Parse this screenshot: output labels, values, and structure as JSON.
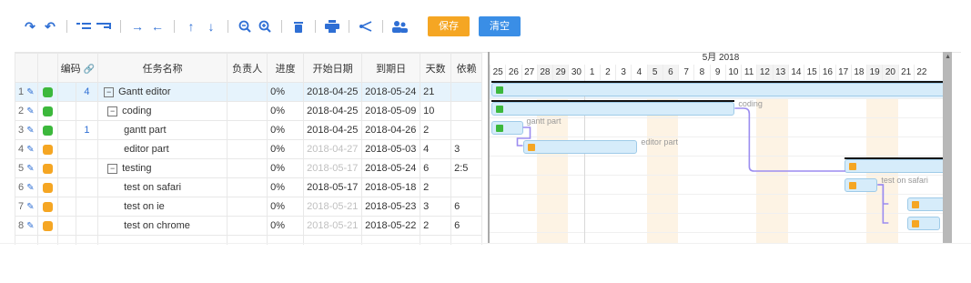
{
  "toolbar": {
    "save_label": "保存",
    "clear_label": "清空"
  },
  "grid": {
    "headers": [
      "编码",
      "任务名称",
      "负责人",
      "进度",
      "开始日期",
      "到期日",
      "天数",
      "依赖"
    ],
    "rows": [
      {
        "num": "1",
        "status": "green",
        "code": "4",
        "expand": "−",
        "name": "Gantt editor",
        "owner": "",
        "progress": "0%",
        "start": "2018-04-25",
        "start_muted": false,
        "end": "2018-05-24",
        "days": "21",
        "deps": ""
      },
      {
        "num": "2",
        "status": "green",
        "code": "",
        "expand": "−",
        "name": "coding",
        "owner": "",
        "progress": "0%",
        "start": "2018-04-25",
        "start_muted": false,
        "end": "2018-05-09",
        "days": "10",
        "deps": ""
      },
      {
        "num": "3",
        "status": "green",
        "code": "1",
        "expand": "",
        "name": "gantt part",
        "owner": "",
        "progress": "0%",
        "start": "2018-04-25",
        "start_muted": false,
        "end": "2018-04-26",
        "days": "2",
        "deps": ""
      },
      {
        "num": "4",
        "status": "orange",
        "code": "",
        "expand": "",
        "name": "editor part",
        "owner": "",
        "progress": "0%",
        "start": "2018-04-27",
        "start_muted": true,
        "end": "2018-05-03",
        "days": "4",
        "deps": "3"
      },
      {
        "num": "5",
        "status": "orange",
        "code": "",
        "expand": "−",
        "name": "testing",
        "owner": "",
        "progress": "0%",
        "start": "2018-05-17",
        "start_muted": true,
        "end": "2018-05-24",
        "days": "6",
        "deps": "2:5"
      },
      {
        "num": "6",
        "status": "orange",
        "code": "",
        "expand": "",
        "name": "test on safari",
        "owner": "",
        "progress": "0%",
        "start": "2018-05-17",
        "start_muted": false,
        "end": "2018-05-18",
        "days": "2",
        "deps": ""
      },
      {
        "num": "7",
        "status": "orange",
        "code": "",
        "expand": "",
        "name": "test on ie",
        "owner": "",
        "progress": "0%",
        "start": "2018-05-21",
        "start_muted": true,
        "end": "2018-05-23",
        "days": "3",
        "deps": "6"
      },
      {
        "num": "8",
        "status": "orange",
        "code": "",
        "expand": "",
        "name": "test on chrome",
        "owner": "",
        "progress": "0%",
        "start": "2018-05-21",
        "start_muted": true,
        "end": "2018-05-22",
        "days": "2",
        "deps": "6"
      }
    ]
  },
  "gantt": {
    "month_label": "5月 2018",
    "days": [
      "25",
      "26",
      "27",
      "28",
      "29",
      "30",
      "1",
      "2",
      "3",
      "4",
      "5",
      "6",
      "7",
      "8",
      "9",
      "10",
      "11",
      "12",
      "13",
      "14",
      "15",
      "16",
      "17",
      "18",
      "19",
      "20",
      "21",
      "22"
    ],
    "bar_labels": {
      "coding": "coding",
      "gantt_part": "gantt part",
      "editor_part": "editor part",
      "test_on_safari": "test on safari"
    }
  },
  "colors": {
    "accent_blue": "#2f6fd4",
    "status_green": "#3cb83c",
    "status_orange": "#f5a623",
    "save_button": "#f5a623",
    "clear_button": "#3a8ee6",
    "selected_row": "#e6f3fc",
    "bar_fill": "#d6ecfa",
    "dependency_line": "#9b8cf0"
  },
  "icons": [
    "undo-icon",
    "redo-icon",
    "indent-icon",
    "outdent-icon",
    "move-right-icon",
    "move-left-icon",
    "move-up-icon",
    "move-down-icon",
    "zoom-out-icon",
    "zoom-in-icon",
    "delete-icon",
    "print-icon",
    "critical-path-icon",
    "resources-icon"
  ]
}
